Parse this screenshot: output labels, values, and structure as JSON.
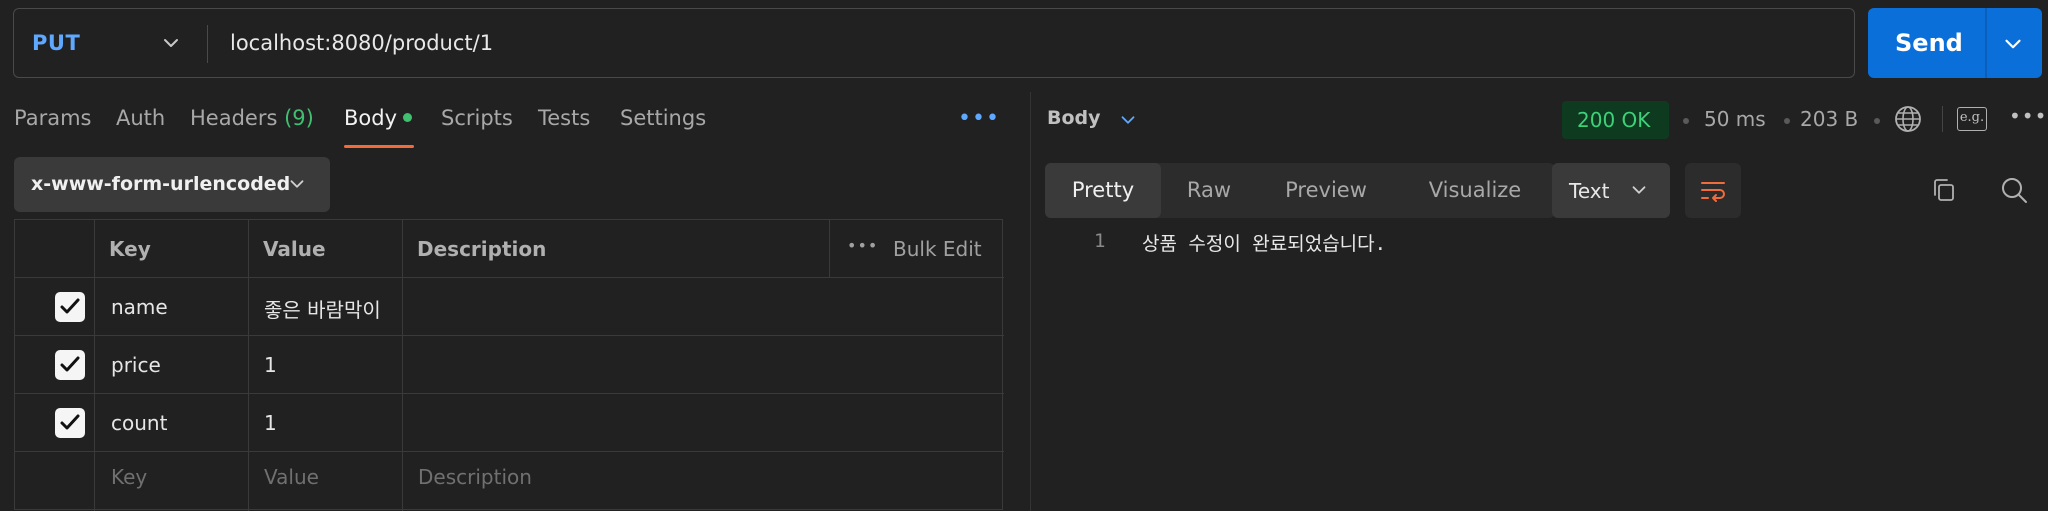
{
  "request": {
    "method": "PUT",
    "url": "localhost:8080/product/1",
    "send_label": "Send"
  },
  "tabs": [
    {
      "label": "Params"
    },
    {
      "label": "Auth"
    },
    {
      "label": "Headers",
      "count": "(9)"
    },
    {
      "label": "Body",
      "active": true
    },
    {
      "label": "Scripts"
    },
    {
      "label": "Tests"
    },
    {
      "label": "Settings"
    }
  ],
  "more_label": "•••",
  "body_type": "x-www-form-urlencoded",
  "params_table": {
    "headers": {
      "key": "Key",
      "value": "Value",
      "description": "Description",
      "bulk_edit": "Bulk Edit",
      "bulk_dots": "•••"
    },
    "rows": [
      {
        "checked": true,
        "key": "name",
        "value": "좋은 바람막이",
        "description": ""
      },
      {
        "checked": true,
        "key": "price",
        "value": "1",
        "description": ""
      },
      {
        "checked": true,
        "key": "count",
        "value": "1",
        "description": ""
      }
    ],
    "placeholder": {
      "key": "Key",
      "value": "Value",
      "description": "Description"
    }
  },
  "response": {
    "section_label": "Body",
    "status": "200 OK",
    "time": "50 ms",
    "size": "203 B",
    "eg_label": "e.g.",
    "kebab": "•••",
    "view_tabs": [
      "Pretty",
      "Raw",
      "Preview",
      "Visualize"
    ],
    "active_view": "Pretty",
    "format": "Text",
    "lines": [
      {
        "no": "1",
        "text": "상품 수정이 완료되었습니다."
      }
    ]
  },
  "colors": {
    "accent_blue": "#0b6fd9",
    "method_blue": "#5fa8ff",
    "status_green": "#3fd07a",
    "active_tab_underline": "#f26b3a"
  }
}
